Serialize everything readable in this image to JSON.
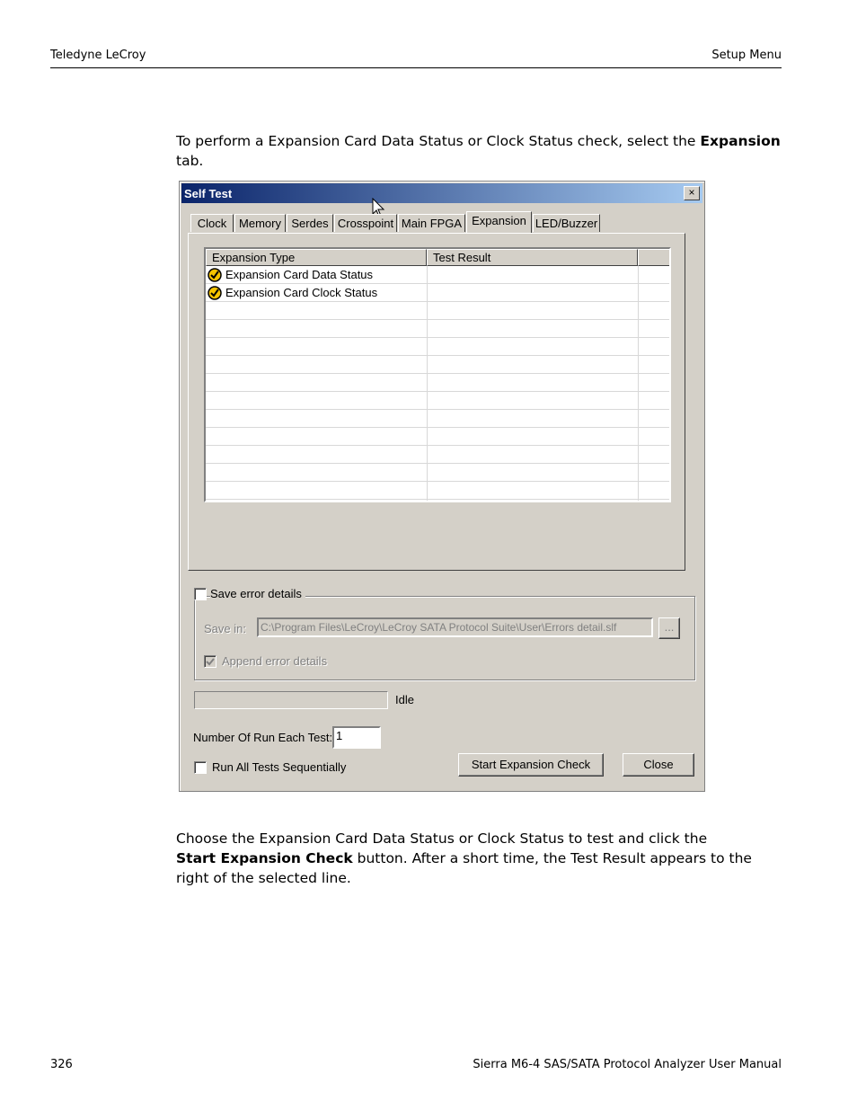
{
  "header": {
    "left": "Teledyne LeCroy",
    "right": "Setup Menu"
  },
  "intro": {
    "before": "To perform a Expansion Card Data Status or Clock Status check, select the ",
    "bold": "Expansion",
    "after": " tab."
  },
  "dialog": {
    "title": "Self Test",
    "close_glyph": "×",
    "tabs": [
      "Clock",
      "Memory",
      "Serdes",
      "Crosspoint",
      "Main FPGA",
      "Expansion",
      "LED/Buzzer"
    ],
    "active_tab": "Expansion",
    "grid": {
      "columns": [
        "Expansion Type",
        "Test Result"
      ],
      "rows": [
        {
          "type": "Expansion Card Data Status",
          "result": ""
        },
        {
          "type": "Expansion Card Clock Status",
          "result": ""
        }
      ]
    },
    "save_error": {
      "label": "Save error details",
      "checked": false
    },
    "save_in": {
      "label": "Save in:",
      "value": "C:\\Program Files\\LeCroy\\LeCroy SATA Protocol Suite\\User\\Errors detail.slf",
      "browse": "..."
    },
    "append": {
      "label": "Append error details",
      "checked": true
    },
    "status": "Idle",
    "run_count": {
      "label": "Number Of Run Each Test:",
      "value": "1"
    },
    "run_all": {
      "label": "Run All Tests Sequentially",
      "checked": false
    },
    "buttons": {
      "start": "Start Expansion Check",
      "close": "Close"
    },
    "icons": {
      "row_icon": "check-circle-icon",
      "cursor": "mouse-pointer-icon"
    }
  },
  "body": {
    "before": "Choose the Expansion Card Data Status or Clock Status to test and click the ",
    "bold": "Start Expansion Check",
    "after": " button. After a short time, the Test Result appears to the right of the selected line."
  },
  "footer": {
    "page": "326",
    "manual": "Sierra M6-4 SAS/SATA Protocol Analyzer User Manual"
  }
}
